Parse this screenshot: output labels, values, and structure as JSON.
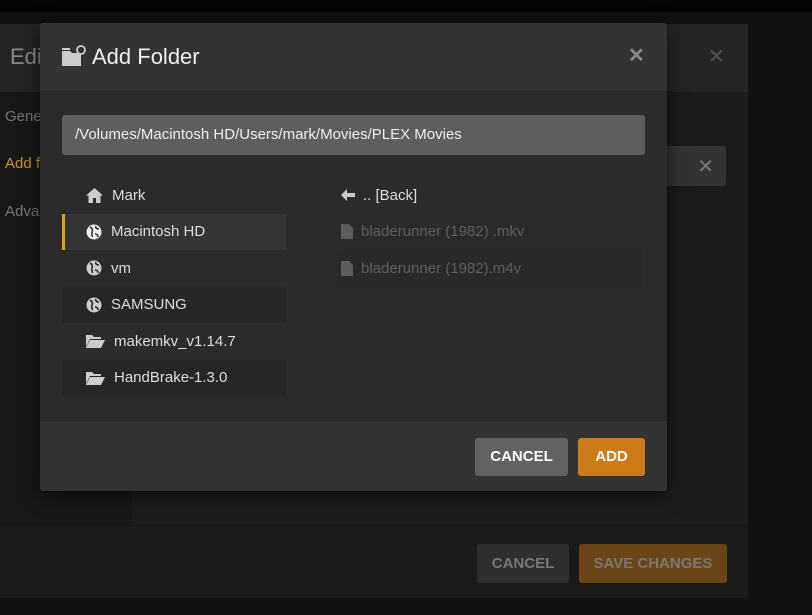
{
  "background_dialog": {
    "title": "Edi",
    "sidebar": [
      {
        "label": "Gene",
        "active": false
      },
      {
        "label": "Add f",
        "active": true
      },
      {
        "label": "Adva",
        "active": false
      }
    ],
    "cancel_label": "CANCEL",
    "save_label": "SAVE CHANGES"
  },
  "modal": {
    "title": "Add Folder",
    "path": "/Volumes/Macintosh HD/Users/mark/Movies/PLEX Movies",
    "locations": [
      {
        "label": "Mark",
        "icon": "home-icon"
      },
      {
        "label": "Macintosh HD",
        "icon": "globe-icon",
        "selected": true
      },
      {
        "label": "vm",
        "icon": "globe-icon"
      },
      {
        "label": "SAMSUNG",
        "icon": "globe-icon"
      },
      {
        "label": "makemkv_v1.14.7",
        "icon": "folder-open-icon"
      },
      {
        "label": "HandBrake-1.3.0",
        "icon": "folder-open-icon"
      }
    ],
    "back_label": ".. [Back]",
    "files": [
      "bladerunner (1982) .mkv",
      "bladerunner (1982).m4v"
    ],
    "cancel_label": "CANCEL",
    "add_label": "ADD"
  },
  "colors": {
    "accent": "#e5a00d",
    "add_button": "#cc7b19",
    "save_button": "#6b4517"
  }
}
